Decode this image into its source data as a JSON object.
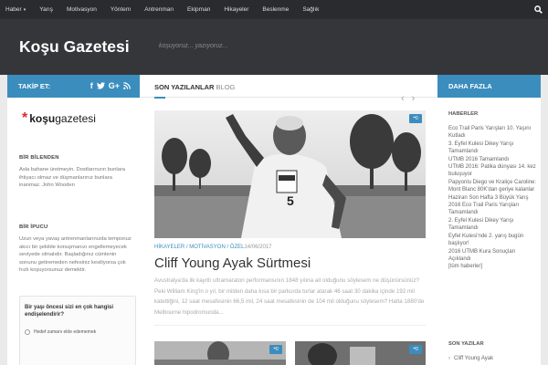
{
  "nav": {
    "items": [
      {
        "label": "Haber",
        "caret": "▾"
      },
      {
        "label": "Yarış"
      },
      {
        "label": "Motivasyon"
      },
      {
        "label": "Yöntem"
      },
      {
        "label": "Antrenman"
      },
      {
        "label": "Ekipman"
      },
      {
        "label": "Hikayeler"
      },
      {
        "label": "Beslenme"
      },
      {
        "label": "Sağlık"
      }
    ],
    "search_icon": "search-icon"
  },
  "header": {
    "brand": "Koşu Gazetesi",
    "tagline": "koşuyoruz... yazıyoruz..."
  },
  "left": {
    "follow_label": "TAKİP ET:",
    "social": [
      "f",
      "t",
      "G+",
      "rss"
    ],
    "logo": {
      "mark": "*",
      "bold": "koşu",
      "rest": "gazetesi"
    },
    "widgets": [
      {
        "title": "BİR BİLENDEN",
        "text": "Asla bahane üretmeyin. Dostlarınızın bunlara ihtiyacı olmaz ve düşmanlarınız bunlara inanmaz. John Wooden"
      },
      {
        "title": "BİR İPUCU",
        "text": "Uzun veya yavaş antrenmanlarınızda temponuz akıcı bir şekilde konuşmanızı engellemeyecek seviyede olmalıdır. Başladığınız cümlenin sonunu getiremeden nefesiniz kesiliyorsa çok hızlı koşuyorsunuz demektir."
      }
    ],
    "poll": {
      "question": "Bir yaşı öncesi sizi en çok hangisi endişelendirir?",
      "option": "Hedef zamanı elde edememek"
    }
  },
  "main": {
    "tab_primary": "SON YAZILANLAR",
    "tab_secondary": "BLOG",
    "arrows": [
      "‹",
      "›"
    ],
    "featured": {
      "comments": "0",
      "category": "HİKAYELER / MOTİVASYON / ÖZEL",
      "date": "14/06/2017",
      "title": "Cliff Young Ayak Sürtmesi",
      "excerpt": "Avustralya'da ilk kayıtlı ultramaraton performansının 1848 yılına ait olduğunu söylesem ne düşünürsünüz? Peki William King'in o yıl, bir milden daha kısa bir parkurda turlar atarak 46 saat 30 dakika içinde 192 mil katettiğini, 12 saat mesafesinin 66,5 mil, 24 saat mesafesinin de 104 mil olduğunu söylesem? Hatta 1880'de Melbourne hipodromunda..."
    },
    "thumbs": [
      {
        "comments": "0"
      },
      {
        "comments": "0"
      }
    ]
  },
  "right": {
    "title": "DAHA FAZLA",
    "news_title": "HABERLER",
    "news": [
      "Eco Trail Paris Yarışları 10. Yaşını Kutladı",
      "3. Eyfel Kulesi Dikey Yarışı Tamamlandı",
      "UTMB 2016 Tamamlandı",
      "UTMB 2016: Patika dünyası 14. kez buluşuyor",
      "Papyonlu Diego ve Kraliçe Caroline: Mont Blanc 80K'dan geriye kalanlar",
      "Haziran Son Hafta 3 Büyük Yarış",
      "2016 Eco Trail Paris Yarışları Tamamlandı",
      "2. Eyfel Kulesi Dikey Yarışı Tamamlandı",
      "Eyfel Kulesi'nde 2. yarış bugün başlıyor!",
      "2016 UTMB Kura Sonuçları Açıklandı"
    ],
    "all_news": "[tüm haberler]",
    "recent_title": "SON YAZILAR",
    "recent_first": "Cliff Young Ayak"
  },
  "colors": {
    "accent": "#3b8dbd",
    "nav": "#2a2b2e",
    "header": "#35363a",
    "logo_star": "#d92b2b"
  }
}
